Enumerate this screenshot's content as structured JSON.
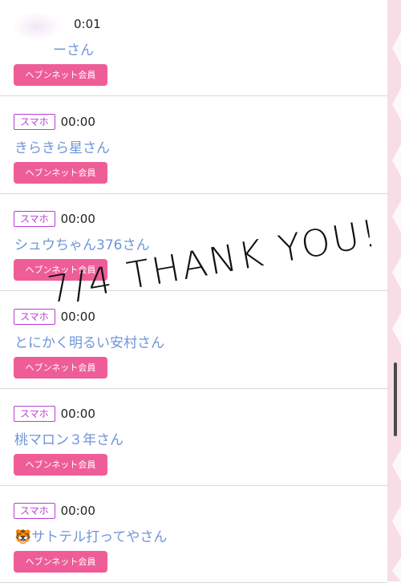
{
  "items": [
    {
      "badge": "",
      "time": "0:01",
      "name": "ーさん",
      "member": "ヘブンネット会員"
    },
    {
      "badge": "スマホ",
      "time": "00:00",
      "name": "きらきら星さん",
      "member": "ヘブンネット会員"
    },
    {
      "badge": "スマホ",
      "time": "00:00",
      "name": "シュウちゃん376さん",
      "member": "ヘブンネット会員"
    },
    {
      "badge": "スマホ",
      "time": "00:00",
      "name": "とにかく明るい安村さん",
      "member": "ヘブンネット会員"
    },
    {
      "badge": "スマホ",
      "time": "00:00",
      "name": "桃マロン３年さん",
      "member": "ヘブンネット会員"
    },
    {
      "badge": "スマホ",
      "time": "00:00",
      "name": "🐯サトテル打ってやさん",
      "member": "ヘブンネット会員"
    }
  ],
  "overlay": {
    "text": "7/4 THANK YOU!"
  },
  "colors": {
    "badge": "#b83fd0",
    "name": "#6e95d8",
    "member_button": "#ef5d98",
    "stripe": "#f7dde5"
  }
}
